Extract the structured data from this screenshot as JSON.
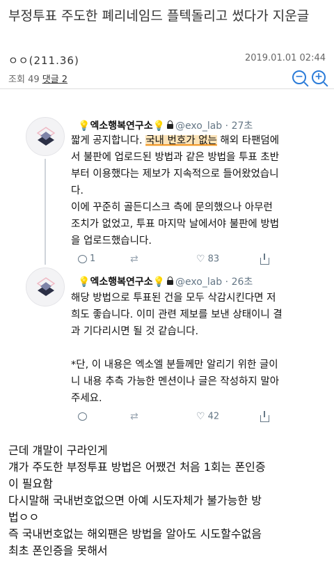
{
  "post": {
    "title": "부정투표 주도한 폐리네임드 플텍돌리고 썼다가 지운글",
    "author": "ㅇㅇ(211.36)",
    "date": "2019.01.01 02:44",
    "views_label": "조회",
    "views": "49",
    "comments_label": "댓글 2"
  },
  "tweets": [
    {
      "name": "엑소행복연구소",
      "handle": "@exo_lab",
      "time": "27초",
      "body_before": "짧게 공지합니다. ",
      "body_highlight": "국내 번호가 없는",
      "body_after": " 해외 타팬덤에\n서 불판에 업로드된 방법과 같은 방법을 투표 초반\n부터 이용했다는 제보가 지속적으로 들어왔었습니\n다.\n이에 꾸준히 골든디스크 측에 문의했으나 아무런\n조치가 없었고, 투표 마지막 날에서야 불판에 방법\n을 업로드했습니다.",
      "replies": "1",
      "likes": "83"
    },
    {
      "name": "엑소행복연구소",
      "handle": "@exo_lab",
      "time": "26초",
      "body": "해당 방법으로 투표된 건을 모두 삭감시킨다면 저\n희도 좋습니다. 이미 관련 제보를 보낸 상태이니 결\n과 기다리시면 될 것 같습니다.\n\n*단, 이 내용은 엑소엘 분들께만 알리기 위한 글이\n니 내용 추측 가능한 멘션이나 글은 작성하지 말아\n주세요.",
      "replies": "",
      "likes": "42"
    }
  ],
  "comment_lines": [
    "근데 걔말이 구라인게",
    "걔가 주도한 부정투표 방법은 어쨌건 처음 1회는 폰인증",
    "이 필요함",
    "다시말해 국내번호없으면 아예 시도자체가 불가능한 방",
    "법ㅇㅇ",
    "즉 국내번호없는 해외팬은 방법을 알아도 시도할수없음",
    "최초 폰인증을 못해서"
  ],
  "colors": {
    "accent_blue": "#2a7bd8",
    "highlight": "#fbe3b8",
    "underline_orange": "#f39a2e",
    "twitter_gray": "#657786"
  }
}
